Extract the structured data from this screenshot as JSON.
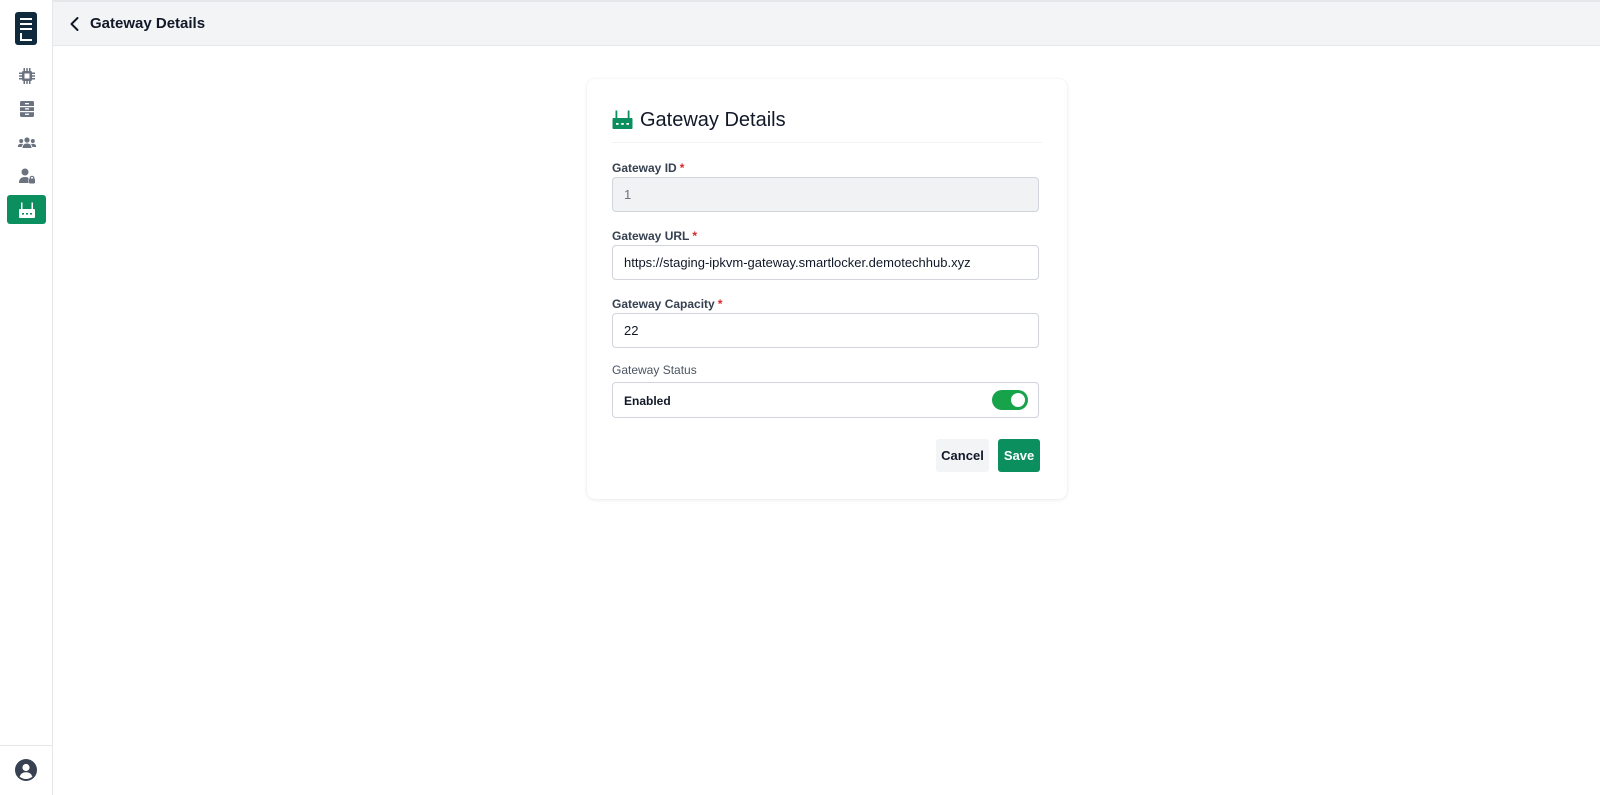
{
  "app": {
    "logo": "logo"
  },
  "sidebar": {
    "items": [
      {
        "icon": "cpu-icon",
        "active": false
      },
      {
        "icon": "server-icon",
        "active": false
      },
      {
        "icon": "users-icon",
        "active": false
      },
      {
        "icon": "user-lock-icon",
        "active": false
      },
      {
        "icon": "router-icon",
        "active": true
      }
    ],
    "footer_icon": "user-circle-icon"
  },
  "header": {
    "title": "Gateway Details",
    "back_icon": "chevron-left-icon"
  },
  "card": {
    "title": "Gateway Details",
    "title_icon": "router-icon",
    "fields": {
      "gateway_id": {
        "label": "Gateway ID",
        "required_mark": "*",
        "value": "1"
      },
      "gateway_url": {
        "label": "Gateway URL",
        "required_mark": "*",
        "value": "https://staging-ipkvm-gateway.smartlocker.demotechhub.xyz"
      },
      "gateway_capacity": {
        "label": "Gateway Capacity",
        "required_mark": "*",
        "value": "22"
      },
      "gateway_status": {
        "label": "Gateway Status",
        "value_label": "Enabled",
        "enabled": true
      }
    },
    "actions": {
      "cancel": "Cancel",
      "save": "Save"
    }
  },
  "colors": {
    "accent": "#0c8f5f",
    "toggle_on": "#16a34a",
    "logo_bg": "#0f2a3d",
    "required": "#dc2626"
  }
}
